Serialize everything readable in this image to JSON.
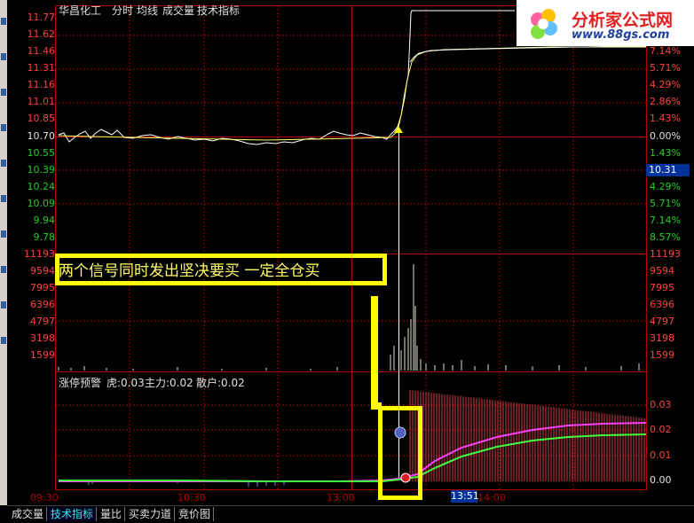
{
  "header": {
    "stock_name": "华昌化工",
    "tab_timeshare": "分时",
    "tab_avgline": "均线",
    "tab_volume": "成交量",
    "tab_indicator": "技术指标"
  },
  "logo": {
    "title": "分析家公式网",
    "url": "www.88gs.com"
  },
  "price_axis": {
    "left_labels": [
      "11.77",
      "11.62",
      "11.46",
      "11.31",
      "11.16",
      "11.01",
      "10.85",
      "10.70",
      "10.55",
      "10.39",
      "10.24",
      "10.09",
      "9.94",
      "9.78"
    ],
    "right_labels": [
      "",
      "",
      "7.14%",
      "5.71%",
      "4.29%",
      "2.86%",
      "1.43%",
      "0.00%",
      "1.43%",
      "",
      "4.29%",
      "5.71%",
      "7.14%",
      "8.57%"
    ],
    "current_price": "10.31"
  },
  "volume_axis": {
    "left_labels": [
      "11193",
      "9594",
      "7995",
      "6396",
      "4797",
      "3198",
      "1599"
    ],
    "right_labels": [
      "11193",
      "9594",
      "7995",
      "6396",
      "4797",
      "3198",
      "1599"
    ]
  },
  "indicator_panel": {
    "legend_name": "涨停预警",
    "legend_tiger": "虎:0.03",
    "legend_main": "主力:0.02",
    "legend_retail": "散户:0.02",
    "right_labels": [
      "0.03",
      "0.02",
      "0.01",
      "0.00"
    ]
  },
  "annotation": {
    "text": "两个信号同时发出坚决要买    一定全仓买"
  },
  "time_axis": {
    "labels": [
      "09:30",
      "10:30",
      "13:00",
      "14:00"
    ],
    "cursor_time": "13:51"
  },
  "bottom_tabs": [
    {
      "label": "成交量",
      "active": false
    },
    {
      "label": "技术指标",
      "active": true
    },
    {
      "label": "量比",
      "active": false
    },
    {
      "label": "买卖力道",
      "active": false
    },
    {
      "label": "竞价图",
      "active": false
    }
  ],
  "colors": {
    "grid_red": "#b00000",
    "price_line": "#ffffff",
    "avg_line": "#ffff00",
    "main_force": "#ff40ff",
    "retail": "#40ff40",
    "highlight": "#ffff00"
  }
}
